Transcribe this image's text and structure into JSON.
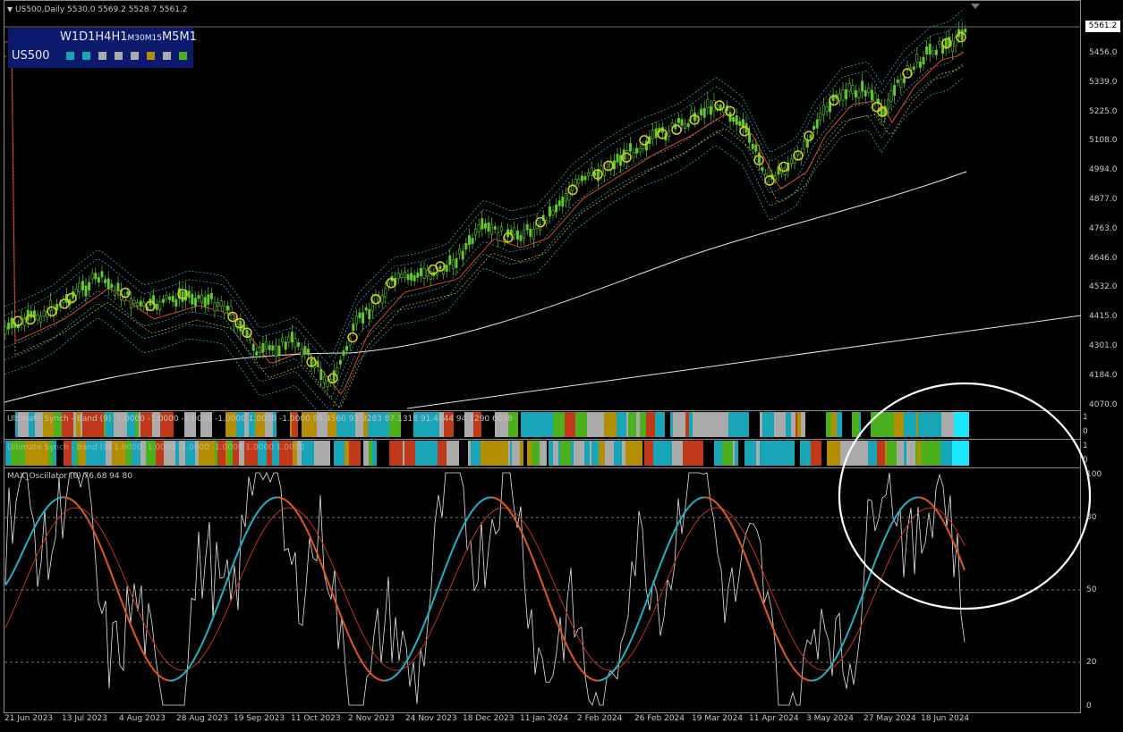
{
  "chart_header": {
    "caret": "▼",
    "title": "US500,Daily  5530.0 5569.2 5528.7 5561.2"
  },
  "timeframe_panel": {
    "symbol": "US500",
    "labels": [
      {
        "text": "W1",
        "small": false
      },
      {
        "text": "D1",
        "small": false
      },
      {
        "text": "H4",
        "small": false
      },
      {
        "text": "H1",
        "small": false
      },
      {
        "text": "M30",
        "small": true
      },
      {
        "text": "M15",
        "small": true
      },
      {
        "text": "M5",
        "small": false
      },
      {
        "text": "M1",
        "small": false
      }
    ],
    "square_colors": [
      "#19a5b8",
      "#19a5b8",
      "#aaaaaa",
      "#aaaaaa",
      "#aaaaaa",
      "#b38e00",
      "#aaaaaa",
      "#4caf1c"
    ]
  },
  "price_axis": {
    "current_price": "5561.2",
    "ticks": [
      "5456.0",
      "5339.0",
      "5225.0",
      "5108.0",
      "4994.0",
      "4877.0",
      "4763.0",
      "4646.0",
      "4532.0",
      "4415.0",
      "4301.0",
      "4184.0",
      "4070.0"
    ]
  },
  "indicator_1": {
    "title": "Ultimate Synch - Band (9) -1.0000 -1.0000 -1.0000 -1.0000 1.0000 -1.0000 99.4560 93.9283 87.1318 91.4844 94.1290 6",
    "title_tail": "058",
    "scale": [
      "1",
      "0"
    ]
  },
  "indicator_2": {
    "title": "Ultimate Synch - Band (9) 1.0000 -1.0000 -1.0000 -1.0000 1.0000 1.0000",
    "scale": [
      "1",
      "0"
    ]
  },
  "oscillator": {
    "title": "MAX_Oscillator (6) 76.68 94 80",
    "levels": [
      "100",
      "80",
      "50",
      "20",
      "0"
    ]
  },
  "time_axis": [
    "21 Jun 2023",
    "13 Jul 2023",
    "4 Aug 2023",
    "28 Aug 2023",
    "19 Sep 2023",
    "11 Oct 2023",
    "2 Nov 2023",
    "24 Nov 2023",
    "18 Dec 2023",
    "11 Jan 2024",
    "2 Feb 2024",
    "26 Feb 2024",
    "19 Mar 2024",
    "11 Apr 2024",
    "3 May 2024",
    "27 May 2024",
    "18 Jun 2024"
  ],
  "colors": {
    "candle": "#5fc92e",
    "ma_fast": "#e0442a",
    "ma_slow": "#e6e6e6",
    "band": "#2fa9b4",
    "band_inner": "#c9b236",
    "osc_main": "#e6e6e6",
    "osc_signal_up": "#1fb5c7",
    "osc_signal_down": "#e05a22",
    "osc_slow": "#c8321c",
    "marker": "#d8cc28",
    "annotation_circle": "#ffffff"
  }
}
